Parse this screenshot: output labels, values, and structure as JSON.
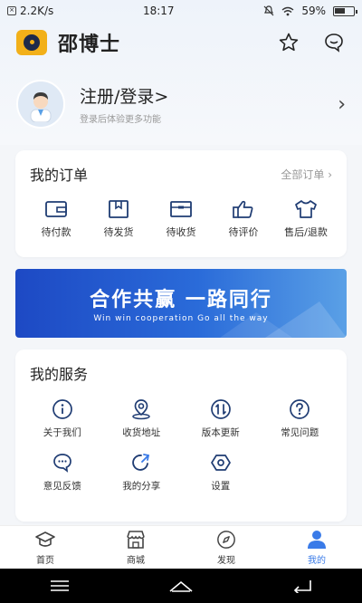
{
  "status_bar": {
    "net_speed": "2.2K/s",
    "time": "18:17",
    "battery": "59%",
    "battery_level": 0.59
  },
  "header": {
    "brand": "邵博士",
    "icons": [
      "star-icon",
      "chat-icon"
    ]
  },
  "profile": {
    "title": "注册/登录>",
    "subtitle": "登录后体验更多功能"
  },
  "orders": {
    "title": "我的订单",
    "all_label": "全部订单 ›",
    "items": [
      {
        "label": "待付款",
        "icon": "wallet-icon"
      },
      {
        "label": "待发货",
        "icon": "package-icon"
      },
      {
        "label": "待收货",
        "icon": "box-icon"
      },
      {
        "label": "待评价",
        "icon": "thumbs-up-icon"
      },
      {
        "label": "售后/退款",
        "icon": "shirt-icon"
      }
    ]
  },
  "banner": {
    "title": "合作共赢 一路同行",
    "subtitle": "Win win cooperation Go all the way"
  },
  "services": {
    "title": "我的服务",
    "items": [
      {
        "label": "关于我们",
        "icon": "info-icon"
      },
      {
        "label": "收货地址",
        "icon": "location-icon"
      },
      {
        "label": "版本更新",
        "icon": "update-icon"
      },
      {
        "label": "常见问题",
        "icon": "question-icon"
      },
      {
        "label": "意见反馈",
        "icon": "feedback-icon"
      },
      {
        "label": "我的分享",
        "icon": "share-icon"
      },
      {
        "label": "设置",
        "icon": "settings-icon"
      }
    ]
  },
  "bottom_nav": {
    "items": [
      {
        "label": "首页",
        "icon": "home-icon"
      },
      {
        "label": "商城",
        "icon": "store-icon"
      },
      {
        "label": "发现",
        "icon": "compass-icon"
      },
      {
        "label": "我的",
        "icon": "user-icon",
        "active": true
      }
    ]
  },
  "colors": {
    "accent": "#3a7be8",
    "icon_stroke": "#1f3c73",
    "brand_yellow": "#f2b019"
  }
}
